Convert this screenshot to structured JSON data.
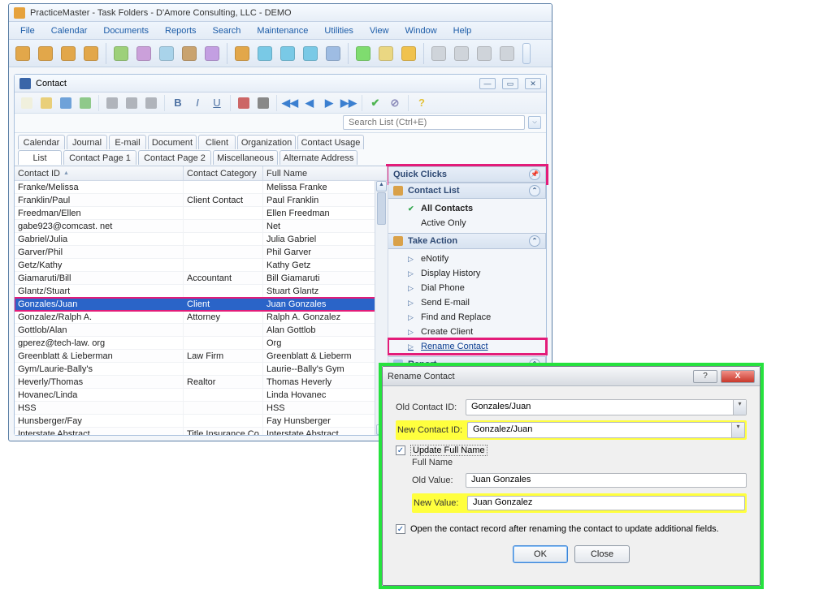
{
  "title": "PracticeMaster - Task Folders - D'Amore Consulting, LLC - DEMO",
  "menus": [
    "File",
    "Calendar",
    "Documents",
    "Reports",
    "Search",
    "Maintenance",
    "Utilities",
    "View",
    "Window",
    "Help"
  ],
  "toolbar_colors": [
    "#e2a74a",
    "#e2a74a",
    "#e2a74a",
    "#e2a74a",
    "#9dd07a",
    "#cba0da",
    "#a9d3ea",
    "#c9a36f",
    "#c39fe2",
    "#e2a74a",
    "#79c9e6",
    "#79c9e6",
    "#79c9e6",
    "#9ebce3",
    "#7fdc6f",
    "#ead782",
    "#f0c24e",
    "#cfd4da",
    "#cfd4da",
    "#cfd4da",
    "#cfd4da"
  ],
  "contact_window": {
    "title": "Contact",
    "search_placeholder": "Search List (Ctrl+E)",
    "tabs_row1": [
      "Calendar",
      "Journal",
      "E-mail",
      "Document",
      "Client",
      "Organization",
      "Contact Usage"
    ],
    "tabs_row2": [
      "List",
      "Contact Page 1",
      "Contact Page 2",
      "Miscellaneous",
      "Alternate Address"
    ],
    "grid_headers": [
      "Contact ID",
      "Contact Category",
      "Full Name"
    ],
    "rows": [
      {
        "id": "Franke/Melissa",
        "cat": "",
        "name": "Melissa Franke"
      },
      {
        "id": "Franklin/Paul",
        "cat": "Client Contact",
        "name": "Paul Franklin"
      },
      {
        "id": "Freedman/Ellen",
        "cat": "",
        "name": "Ellen Freedman"
      },
      {
        "id": "gabe923@comcast. net",
        "cat": "",
        "name": "Net"
      },
      {
        "id": "Gabriel/Julia",
        "cat": "",
        "name": "Julia Gabriel"
      },
      {
        "id": "Garver/Phil",
        "cat": "",
        "name": "Phil Garver"
      },
      {
        "id": "Getz/Kathy",
        "cat": "",
        "name": "Kathy Getz"
      },
      {
        "id": "Giamaruti/Bill",
        "cat": "Accountant",
        "name": "Bill Giamaruti"
      },
      {
        "id": "Glantz/Stuart",
        "cat": "",
        "name": "Stuart Glantz"
      },
      {
        "id": "Gonzales/Juan",
        "cat": "Client",
        "name": "Juan Gonzales",
        "selected": true
      },
      {
        "id": "Gonzalez/Ralph A.",
        "cat": "Attorney",
        "name": "Ralph A. Gonzalez"
      },
      {
        "id": "Gottlob/Alan",
        "cat": "",
        "name": "Alan Gottlob"
      },
      {
        "id": "gperez@tech-law. org",
        "cat": "",
        "name": "Org"
      },
      {
        "id": "Greenblatt & Lieberman",
        "cat": "Law Firm",
        "name": "Greenblatt & Lieberm"
      },
      {
        "id": "Gym/Laurie-Bally's",
        "cat": "",
        "name": "Laurie--Bally's Gym"
      },
      {
        "id": "Heverly/Thomas",
        "cat": "Realtor",
        "name": "Thomas Heverly"
      },
      {
        "id": "Hovanec/Linda",
        "cat": "",
        "name": "Linda Hovanec"
      },
      {
        "id": "HSS",
        "cat": "",
        "name": "HSS"
      },
      {
        "id": "Hunsberger/Fay",
        "cat": "",
        "name": "Fay Hunsberger"
      },
      {
        "id": "Interstate Abstract",
        "cat": "Title Insurance Co",
        "name": "Interstate Abstract"
      }
    ]
  },
  "side": {
    "quick_clicks": "Quick Clicks",
    "contact_list": {
      "title": "Contact List",
      "items": [
        "All Contacts",
        "Active Only"
      ]
    },
    "take_action": {
      "title": "Take Action",
      "items": [
        "eNotify",
        "Display History",
        "Dial Phone",
        "Send E-mail",
        "Find and Replace",
        "Create Client",
        "Rename Contact"
      ]
    },
    "report": {
      "title": "Report"
    }
  },
  "dialog": {
    "title": "Rename Contact",
    "old_label": "Old Contact ID:",
    "new_label": "New Contact ID:",
    "old_value": "Gonzales/Juan",
    "new_value": "Gonzalez/Juan",
    "upd_label": "Update Full Name",
    "fn_header": "Full Name",
    "fn_old_lbl": "Old Value:",
    "fn_new_lbl": "New Value:",
    "fn_old": "Juan Gonzales",
    "fn_new": "Juan Gonzalez",
    "open_label": "Open the contact record after renaming the contact to update additional fields.",
    "ok": "OK",
    "close": "Close",
    "help": "?"
  }
}
